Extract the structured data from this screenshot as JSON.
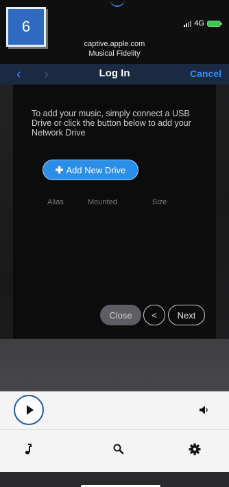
{
  "step_badge": "6",
  "status": {
    "network": "4G"
  },
  "captive": {
    "host": "captive.apple.com",
    "subtitle": "Musical Fidelity"
  },
  "nav": {
    "title": "Log In",
    "cancel": "Cancel",
    "back_icon": "chevron-left-icon",
    "forward_icon": "chevron-right-icon"
  },
  "content": {
    "intro": "To add your music, simply connect a USB Drive or click the button below to add your Network Drive",
    "add_button": "Add New Drive",
    "columns": [
      "Alias",
      "Mounted",
      "Size"
    ]
  },
  "wizard": {
    "close": "Close",
    "prev": "<",
    "next": "Next"
  },
  "player": {
    "play_icon": "play-icon",
    "volume_icon": "volume-icon"
  },
  "tabs": [
    "music-note-icon",
    "search-icon",
    "gear-icon"
  ],
  "colors": {
    "accent": "#2b8ee8",
    "nav_bg": "#1b2a43",
    "badge": "#2e6bc0"
  }
}
